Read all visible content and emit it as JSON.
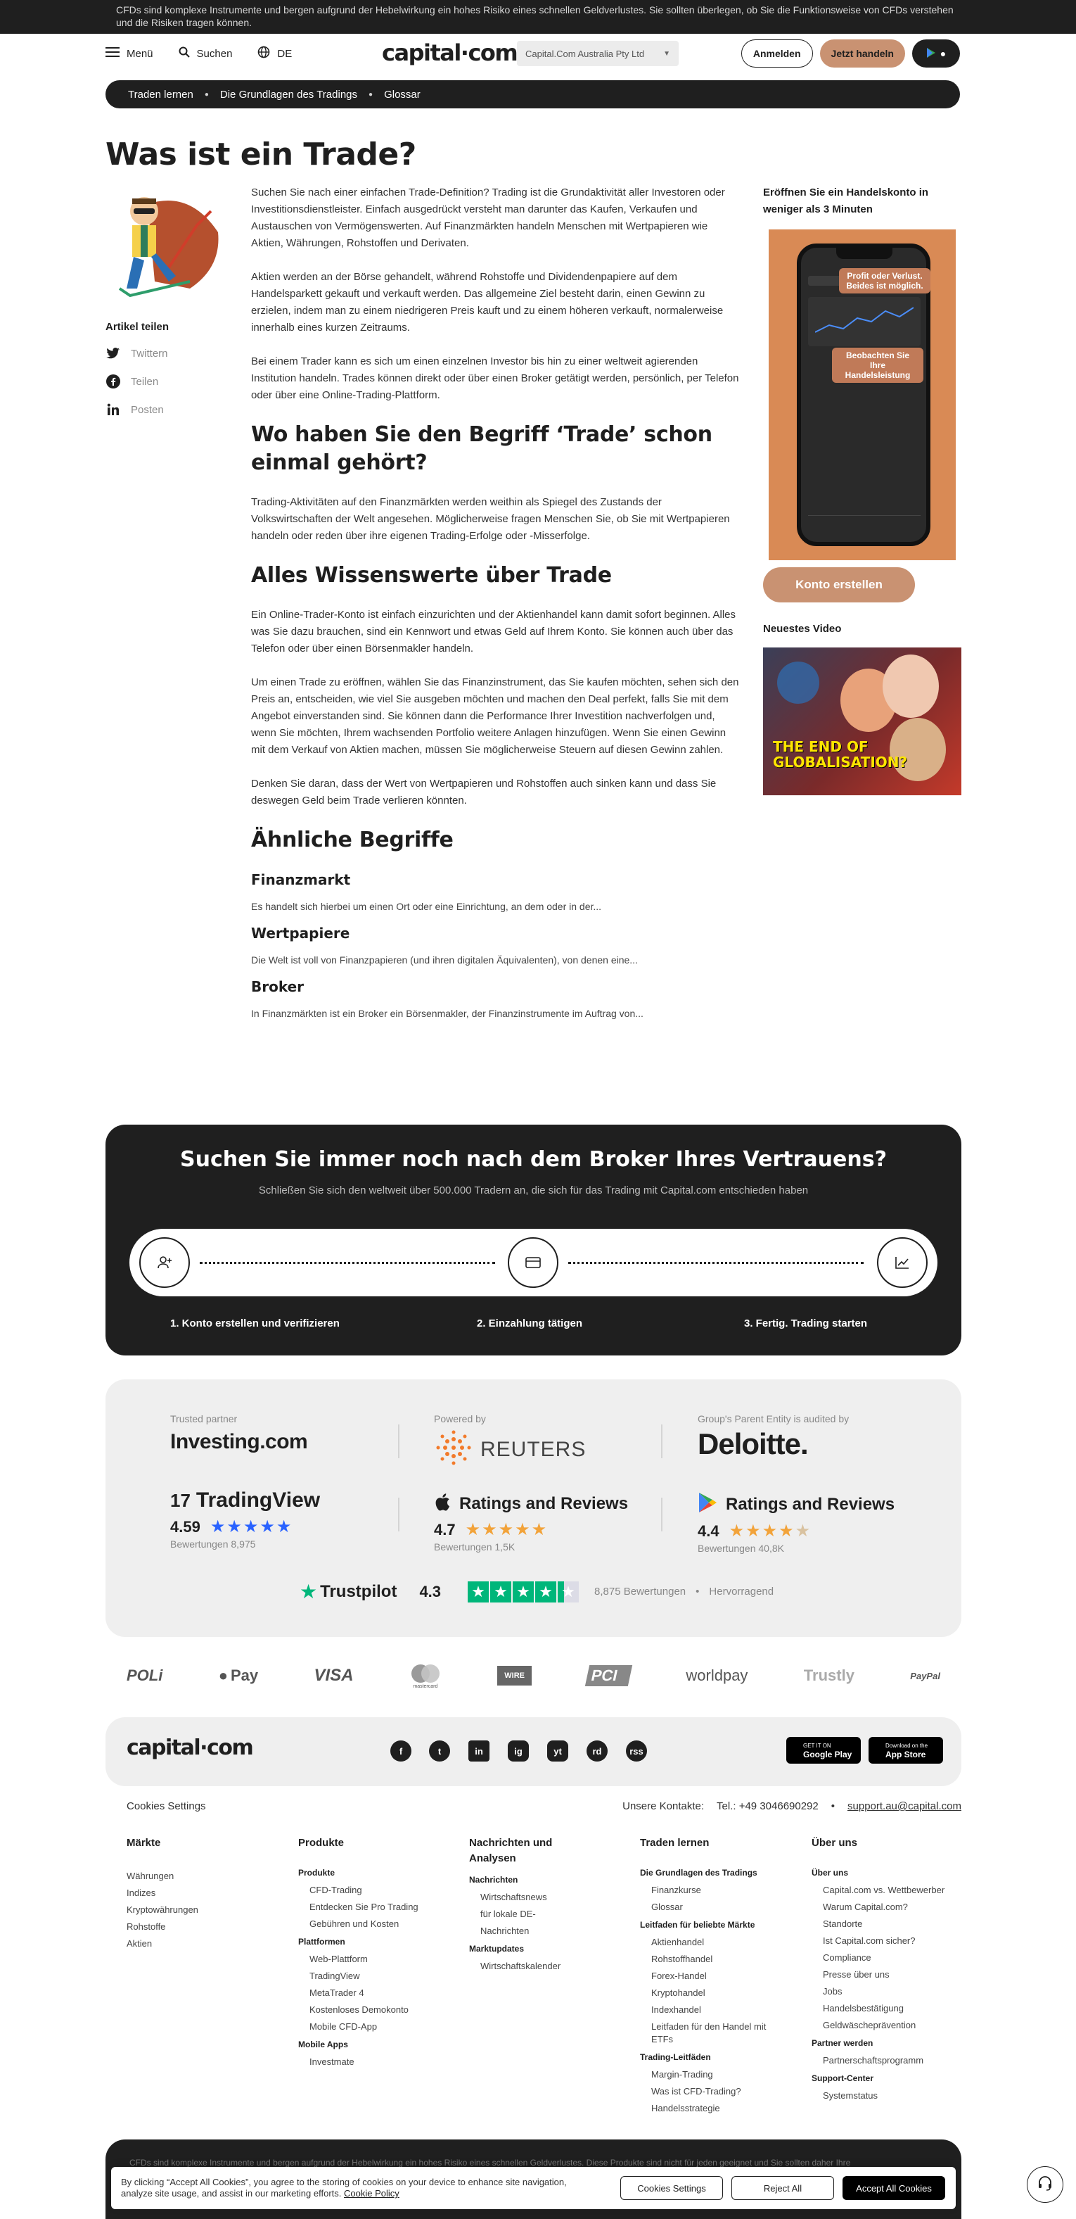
{
  "risk_banner": "CFDs sind komplexe Instrumente und bergen aufgrund der Hebelwirkung ein hohes Risiko eines schnellen Geldverlustes. Sie sollten überlegen, ob Sie die Funktionsweise von CFDs verstehen und die Risiken tragen können.",
  "header": {
    "menu": "Menü",
    "search": "Suchen",
    "lang": "DE",
    "logo": "capital·com",
    "entity": "Capital.Com Australia Pty Ltd",
    "login": "Anmelden",
    "trade_now": "Jetzt handeln"
  },
  "breadcrumb": [
    "Traden lernen",
    "Die Grundlagen des Tradings",
    "Glossar"
  ],
  "title": "Was ist ein Trade?",
  "share": {
    "heading": "Artikel teilen",
    "items": [
      "Twittern",
      "Teilen",
      "Posten"
    ]
  },
  "article": {
    "p1": "Suchen Sie nach einer einfachen Trade-Definition? Trading ist die Grundaktivität aller Investoren oder Investitionsdienstleister. Einfach ausgedrückt versteht man darunter das Kaufen, Verkaufen und Austauschen von Vermögenswerten. Auf Finanzmärkten handeln Menschen mit Wertpapieren wie Aktien, Währungen, Rohstoffen und Derivaten.",
    "p2": "Aktien werden an der Börse gehandelt, während Rohstoffe und Dividendenpapiere auf dem Handelsparkett gekauft und verkauft werden. Das allgemeine Ziel besteht darin, einen Gewinn zu erzielen, indem man zu einem niedrigeren Preis kauft und zu einem höheren verkauft, normalerweise innerhalb eines kurzen Zeitraums.",
    "p3": "Bei einem Trader kann es sich um einen einzelnen Investor bis hin zu einer weltweit agierenden Institution handeln. Trades können direkt oder über einen Broker getätigt werden, persönlich, per Telefon oder über eine Online-Trading-Plattform.",
    "h2a": "Wo haben Sie den Begriff ‘Trade’ schon einmal gehört?",
    "p4": "Trading-Aktivitäten auf den Finanzmärkten werden weithin als Spiegel des Zustands der Volkswirtschaften der Welt angesehen. Möglicherweise fragen Menschen Sie, ob Sie mit Wertpapieren handeln oder reden über ihre eigenen Trading-Erfolge oder -Misserfolge.",
    "h2b": "Alles Wissenswerte über Trade",
    "p5": "Ein Online-Trader-Konto ist einfach einzurichten und der Aktienhandel kann damit sofort beginnen. Alles was Sie dazu brauchen, sind ein Kennwort und etwas Geld auf Ihrem Konto. Sie können auch über das Telefon oder über einen Börsenmakler handeln.",
    "p6": "Um einen Trade zu eröffnen, wählen Sie das Finanzinstrument, das Sie kaufen möchten, sehen sich den Preis an, entscheiden, wie viel Sie ausgeben möchten und machen den Deal perfekt, falls Sie mit dem Angebot einverstanden sind. Sie können dann die Performance Ihrer Investition nachverfolgen und, wenn Sie möchten, Ihrem wachsenden Portfolio weitere Anlagen hinzufügen. Wenn Sie einen Gewinn mit dem Verkauf von Aktien machen, müssen Sie möglicherweise Steuern auf diesen Gewinn zahlen.",
    "p7": "Denken Sie daran, dass der Wert von Wertpapieren und Rohstoffen auch sinken kann und dass Sie deswegen Geld beim Trade verlieren könnten.",
    "h2c": "Ähnliche Begriffe",
    "related": [
      {
        "term": "Finanzmarkt",
        "desc": "Es handelt sich hierbei um einen Ort oder eine Einrichtung, an dem oder in der..."
      },
      {
        "term": "Wertpapiere",
        "desc": "Die Welt ist voll von Finanzpapieren (und ihren digitalen Äquivalenten), von denen eine..."
      },
      {
        "term": "Broker",
        "desc": "In Finanzmärkten ist ein Broker ein Börsenmakler, der Finanzinstrumente im Auftrag von..."
      }
    ]
  },
  "sidebar": {
    "promo_heading": "Eröffnen Sie ein Handelskonto in weniger als 3 Minuten",
    "tag1": "Profit oder Verlust. Beides ist möglich.",
    "tag2": "Beobachten Sie Ihre Handelsleistung",
    "cta": "Konto erstellen",
    "video_heading": "Neuestes Video",
    "video_text": "THE END OF GLOBALISATION?"
  },
  "broker_cta": {
    "title": "Suchen Sie immer noch nach dem Broker Ihres Vertrauens?",
    "subtitle": "Schließen Sie sich den weltweit über 500.000 Tradern an, die sich für das Trading mit Capital.com entschieden haben",
    "steps": [
      "1. Konto erstellen und verifizieren",
      "2. Einzahlung tätigen",
      "3. Fertig. Trading starten"
    ]
  },
  "trust": {
    "partner_label": "Trusted partner",
    "partner": "Investing.com",
    "powered_label": "Powered by",
    "powered": "REUTERS",
    "audit_label": "Group's Parent Entity is audited by",
    "audit": "Deloitte.",
    "tv_name": "TradingView",
    "tv_rating": "4.59",
    "tv_reviews": "Bewertungen 8,975",
    "apple_title": "Ratings and Reviews",
    "apple_rating": "4.7",
    "apple_reviews": "Bewertungen 1,5K",
    "google_title": "Ratings and Reviews",
    "google_rating": "4.4",
    "google_reviews": "Bewertungen 40,8K",
    "tp_name": "Trustpilot",
    "tp_rating": "4.3",
    "tp_reviews": "8,875 Bewertungen",
    "tp_label": "Hervorragend",
    "colors": {
      "stars": "#f2a33a",
      "trustpilot": "#00b67a",
      "tradingview_stars": "#2962ff"
    }
  },
  "payments": [
    "POLi",
    "Pay",
    "VISA",
    "mastercard",
    "WIRE",
    "PCI",
    "worldpay",
    "Trustly",
    "PayPal"
  ],
  "footer": {
    "logo": "capital·com",
    "social": [
      "f",
      "t",
      "in",
      "ig",
      "yt",
      "rd",
      "rss"
    ],
    "google_play_small": "GET IT ON",
    "google_play": "Google Play",
    "app_store_small": "Download on the",
    "app_store": "App Store",
    "cookies_settings": "Cookies Settings",
    "contacts_label": "Unsere Kontakte:",
    "phone": "Tel.: +49 3046690292",
    "email": "support.au@capital.com",
    "cols": [
      {
        "title": "Märkte",
        "items": [
          "Währungen",
          "Indizes",
          "Kryptowährungen",
          "Rohstoffe",
          "Aktien"
        ]
      },
      {
        "title": "Produkte",
        "sections": [
          {
            "name": "Produkte",
            "items": [
              "CFD-Trading",
              "Entdecken Sie Pro Trading",
              "Gebühren und Kosten"
            ]
          },
          {
            "name": "Plattformen",
            "items": [
              "Web-Plattform",
              "TradingView",
              "MetaTrader 4",
              "Kostenloses Demokonto",
              "Mobile CFD-App"
            ]
          },
          {
            "name": "Mobile Apps",
            "items": [
              "Investmate"
            ]
          }
        ]
      },
      {
        "title": "Nachrichten und Analysen",
        "sections": [
          {
            "name": "Nachrichten",
            "items": [
              "Wirtschaftsnews",
              "für lokale DE-Nachrichten"
            ]
          },
          {
            "name": "Marktupdates",
            "items": [
              "Wirtschaftskalender"
            ]
          }
        ]
      },
      {
        "title": "Traden lernen",
        "sections": [
          {
            "name": "Die Grundlagen des Tradings",
            "items": [
              "Finanzkurse",
              "Glossar"
            ]
          },
          {
            "name": "Leitfaden für beliebte Märkte",
            "items": [
              "Aktienhandel",
              "Rohstoffhandel",
              "Forex-Handel",
              "Kryptohandel",
              "Indexhandel",
              "Leitfaden für den Handel mit ETFs"
            ]
          },
          {
            "name": "Trading-Leitfäden",
            "items": [
              "Margin-Trading",
              "Was ist CFD-Trading?",
              "Handelsstrategie"
            ]
          }
        ]
      },
      {
        "title": "Über uns",
        "sections": [
          {
            "name": "Über uns",
            "items": [
              "Capital.com vs. Wettbewerber",
              "Warum Capital.com?",
              "Standorte",
              "Ist Capital.com sicher?",
              "Compliance",
              "Presse über uns",
              "Jobs",
              "Handelsbestätigung",
              "Geldwäscheprävention"
            ]
          },
          {
            "name": "Partner werden",
            "items": [
              "Partnerschaftsprogramm"
            ]
          },
          {
            "name": "Support-Center",
            "items": [
              "Systemstatus"
            ]
          }
        ]
      }
    ]
  },
  "bottom_risk": "CFDs sind komplexe Instrumente und bergen aufgrund der Hebelwirkung ein hohes Risiko eines schnellen Geldverlustes. Diese Produkte sind nicht für jeden geeignet und Sie sollten daher Ihre",
  "cookie_banner": {
    "text": "By clicking “Accept All Cookies”, you agree to the storing of cookies on your device to enhance site navigation, analyze site usage, and assist in our marketing efforts.",
    "policy": "Cookie Policy",
    "settings": "Cookies Settings",
    "reject": "Reject All",
    "accept": "Accept All Cookies"
  }
}
